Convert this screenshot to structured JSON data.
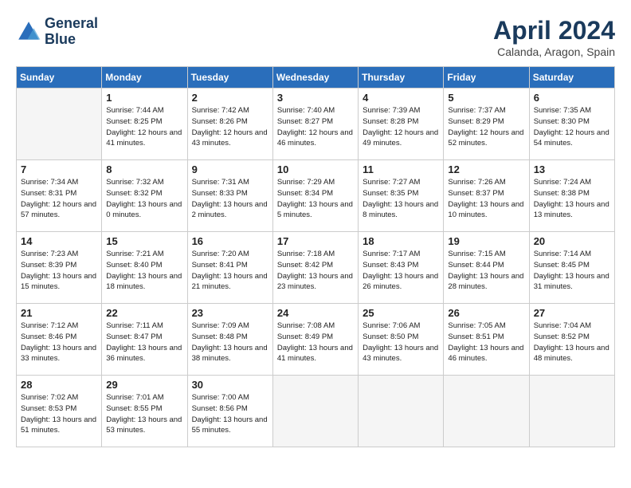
{
  "header": {
    "logo_line1": "General",
    "logo_line2": "Blue",
    "month_year": "April 2024",
    "location": "Calanda, Aragon, Spain"
  },
  "weekdays": [
    "Sunday",
    "Monday",
    "Tuesday",
    "Wednesday",
    "Thursday",
    "Friday",
    "Saturday"
  ],
  "weeks": [
    [
      {
        "day": "",
        "empty": true
      },
      {
        "day": "1",
        "sunrise": "Sunrise: 7:44 AM",
        "sunset": "Sunset: 8:25 PM",
        "daylight": "Daylight: 12 hours and 41 minutes."
      },
      {
        "day": "2",
        "sunrise": "Sunrise: 7:42 AM",
        "sunset": "Sunset: 8:26 PM",
        "daylight": "Daylight: 12 hours and 43 minutes."
      },
      {
        "day": "3",
        "sunrise": "Sunrise: 7:40 AM",
        "sunset": "Sunset: 8:27 PM",
        "daylight": "Daylight: 12 hours and 46 minutes."
      },
      {
        "day": "4",
        "sunrise": "Sunrise: 7:39 AM",
        "sunset": "Sunset: 8:28 PM",
        "daylight": "Daylight: 12 hours and 49 minutes."
      },
      {
        "day": "5",
        "sunrise": "Sunrise: 7:37 AM",
        "sunset": "Sunset: 8:29 PM",
        "daylight": "Daylight: 12 hours and 52 minutes."
      },
      {
        "day": "6",
        "sunrise": "Sunrise: 7:35 AM",
        "sunset": "Sunset: 8:30 PM",
        "daylight": "Daylight: 12 hours and 54 minutes."
      }
    ],
    [
      {
        "day": "7",
        "sunrise": "Sunrise: 7:34 AM",
        "sunset": "Sunset: 8:31 PM",
        "daylight": "Daylight: 12 hours and 57 minutes."
      },
      {
        "day": "8",
        "sunrise": "Sunrise: 7:32 AM",
        "sunset": "Sunset: 8:32 PM",
        "daylight": "Daylight: 13 hours and 0 minutes."
      },
      {
        "day": "9",
        "sunrise": "Sunrise: 7:31 AM",
        "sunset": "Sunset: 8:33 PM",
        "daylight": "Daylight: 13 hours and 2 minutes."
      },
      {
        "day": "10",
        "sunrise": "Sunrise: 7:29 AM",
        "sunset": "Sunset: 8:34 PM",
        "daylight": "Daylight: 13 hours and 5 minutes."
      },
      {
        "day": "11",
        "sunrise": "Sunrise: 7:27 AM",
        "sunset": "Sunset: 8:35 PM",
        "daylight": "Daylight: 13 hours and 8 minutes."
      },
      {
        "day": "12",
        "sunrise": "Sunrise: 7:26 AM",
        "sunset": "Sunset: 8:37 PM",
        "daylight": "Daylight: 13 hours and 10 minutes."
      },
      {
        "day": "13",
        "sunrise": "Sunrise: 7:24 AM",
        "sunset": "Sunset: 8:38 PM",
        "daylight": "Daylight: 13 hours and 13 minutes."
      }
    ],
    [
      {
        "day": "14",
        "sunrise": "Sunrise: 7:23 AM",
        "sunset": "Sunset: 8:39 PM",
        "daylight": "Daylight: 13 hours and 15 minutes."
      },
      {
        "day": "15",
        "sunrise": "Sunrise: 7:21 AM",
        "sunset": "Sunset: 8:40 PM",
        "daylight": "Daylight: 13 hours and 18 minutes."
      },
      {
        "day": "16",
        "sunrise": "Sunrise: 7:20 AM",
        "sunset": "Sunset: 8:41 PM",
        "daylight": "Daylight: 13 hours and 21 minutes."
      },
      {
        "day": "17",
        "sunrise": "Sunrise: 7:18 AM",
        "sunset": "Sunset: 8:42 PM",
        "daylight": "Daylight: 13 hours and 23 minutes."
      },
      {
        "day": "18",
        "sunrise": "Sunrise: 7:17 AM",
        "sunset": "Sunset: 8:43 PM",
        "daylight": "Daylight: 13 hours and 26 minutes."
      },
      {
        "day": "19",
        "sunrise": "Sunrise: 7:15 AM",
        "sunset": "Sunset: 8:44 PM",
        "daylight": "Daylight: 13 hours and 28 minutes."
      },
      {
        "day": "20",
        "sunrise": "Sunrise: 7:14 AM",
        "sunset": "Sunset: 8:45 PM",
        "daylight": "Daylight: 13 hours and 31 minutes."
      }
    ],
    [
      {
        "day": "21",
        "sunrise": "Sunrise: 7:12 AM",
        "sunset": "Sunset: 8:46 PM",
        "daylight": "Daylight: 13 hours and 33 minutes."
      },
      {
        "day": "22",
        "sunrise": "Sunrise: 7:11 AM",
        "sunset": "Sunset: 8:47 PM",
        "daylight": "Daylight: 13 hours and 36 minutes."
      },
      {
        "day": "23",
        "sunrise": "Sunrise: 7:09 AM",
        "sunset": "Sunset: 8:48 PM",
        "daylight": "Daylight: 13 hours and 38 minutes."
      },
      {
        "day": "24",
        "sunrise": "Sunrise: 7:08 AM",
        "sunset": "Sunset: 8:49 PM",
        "daylight": "Daylight: 13 hours and 41 minutes."
      },
      {
        "day": "25",
        "sunrise": "Sunrise: 7:06 AM",
        "sunset": "Sunset: 8:50 PM",
        "daylight": "Daylight: 13 hours and 43 minutes."
      },
      {
        "day": "26",
        "sunrise": "Sunrise: 7:05 AM",
        "sunset": "Sunset: 8:51 PM",
        "daylight": "Daylight: 13 hours and 46 minutes."
      },
      {
        "day": "27",
        "sunrise": "Sunrise: 7:04 AM",
        "sunset": "Sunset: 8:52 PM",
        "daylight": "Daylight: 13 hours and 48 minutes."
      }
    ],
    [
      {
        "day": "28",
        "sunrise": "Sunrise: 7:02 AM",
        "sunset": "Sunset: 8:53 PM",
        "daylight": "Daylight: 13 hours and 51 minutes."
      },
      {
        "day": "29",
        "sunrise": "Sunrise: 7:01 AM",
        "sunset": "Sunset: 8:55 PM",
        "daylight": "Daylight: 13 hours and 53 minutes."
      },
      {
        "day": "30",
        "sunrise": "Sunrise: 7:00 AM",
        "sunset": "Sunset: 8:56 PM",
        "daylight": "Daylight: 13 hours and 55 minutes."
      },
      {
        "day": "",
        "empty": true
      },
      {
        "day": "",
        "empty": true
      },
      {
        "day": "",
        "empty": true
      },
      {
        "day": "",
        "empty": true
      }
    ]
  ]
}
